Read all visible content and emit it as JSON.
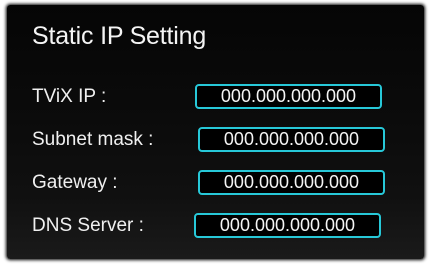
{
  "dialog": {
    "title": "Static IP Setting",
    "fields": [
      {
        "label": "TViX IP :",
        "value": "000.000.000.000"
      },
      {
        "label": "Subnet mask :",
        "value": "000.000.000.000"
      },
      {
        "label": "Gateway :",
        "value": "000.000.000.000"
      },
      {
        "label": "DNS Server :",
        "value": "000.000.000.000"
      }
    ],
    "accent_color": "#27c8d8",
    "background_color": "#0b0b0b"
  }
}
